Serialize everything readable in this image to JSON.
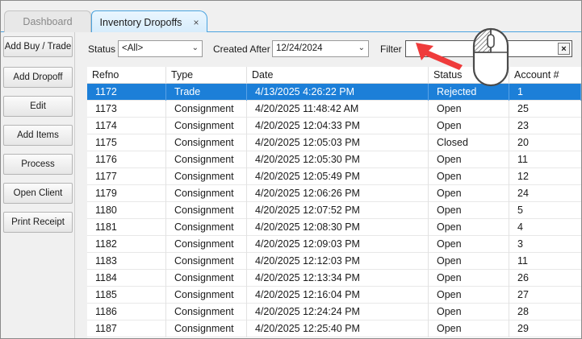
{
  "tabs": {
    "dashboard": "Dashboard",
    "inventory": "Inventory Dropoffs",
    "close_glyph": "×"
  },
  "sidebar": {
    "buttons": [
      "Add Buy / Trade",
      "Add Dropoff",
      "Edit",
      "Add Items",
      "Process",
      "Open Client",
      "Print Receipt"
    ]
  },
  "toolbar": {
    "status_label": "Status",
    "status_value": "<All>",
    "created_after_label": "Created After",
    "created_after_value": "12/24/2024",
    "filter_label": "Filter",
    "filter_value": "",
    "filter_clear": "×"
  },
  "grid": {
    "columns": [
      "Refno",
      "Type",
      "Date",
      "Status",
      "Account #"
    ],
    "rows": [
      {
        "refno": "1172",
        "type": "Trade",
        "date": "4/13/2025 4:26:22 PM",
        "status": "Rejected",
        "account": "1"
      },
      {
        "refno": "1173",
        "type": "Consignment",
        "date": "4/20/2025 11:48:42 AM",
        "status": "Open",
        "account": "25"
      },
      {
        "refno": "1174",
        "type": "Consignment",
        "date": "4/20/2025 12:04:33 PM",
        "status": "Open",
        "account": "23"
      },
      {
        "refno": "1175",
        "type": "Consignment",
        "date": "4/20/2025 12:05:03 PM",
        "status": "Closed",
        "account": "20"
      },
      {
        "refno": "1176",
        "type": "Consignment",
        "date": "4/20/2025 12:05:30 PM",
        "status": "Open",
        "account": "11"
      },
      {
        "refno": "1177",
        "type": "Consignment",
        "date": "4/20/2025 12:05:49 PM",
        "status": "Open",
        "account": "12"
      },
      {
        "refno": "1179",
        "type": "Consignment",
        "date": "4/20/2025 12:06:26 PM",
        "status": "Open",
        "account": "24"
      },
      {
        "refno": "1180",
        "type": "Consignment",
        "date": "4/20/2025 12:07:52 PM",
        "status": "Open",
        "account": "5"
      },
      {
        "refno": "1181",
        "type": "Consignment",
        "date": "4/20/2025 12:08:30 PM",
        "status": "Open",
        "account": "4"
      },
      {
        "refno": "1182",
        "type": "Consignment",
        "date": "4/20/2025 12:09:03 PM",
        "status": "Open",
        "account": "3"
      },
      {
        "refno": "1183",
        "type": "Consignment",
        "date": "4/20/2025 12:12:03 PM",
        "status": "Open",
        "account": "11"
      },
      {
        "refno": "1184",
        "type": "Consignment",
        "date": "4/20/2025 12:13:34 PM",
        "status": "Open",
        "account": "26"
      },
      {
        "refno": "1185",
        "type": "Consignment",
        "date": "4/20/2025 12:16:04 PM",
        "status": "Open",
        "account": "27"
      },
      {
        "refno": "1186",
        "type": "Consignment",
        "date": "4/20/2025 12:24:24 PM",
        "status": "Open",
        "account": "28"
      },
      {
        "refno": "1187",
        "type": "Consignment",
        "date": "4/20/2025 12:25:40 PM",
        "status": "Open",
        "account": "29"
      }
    ],
    "selected_index": 0
  },
  "overlay": {
    "arrow_icon": "red-arrow-icon",
    "mouse_icon": "mouse-left-click-icon"
  },
  "colors": {
    "selection": "#1c7fd8",
    "tab_accent": "#4aa3df",
    "arrow": "#ef3b3b"
  }
}
